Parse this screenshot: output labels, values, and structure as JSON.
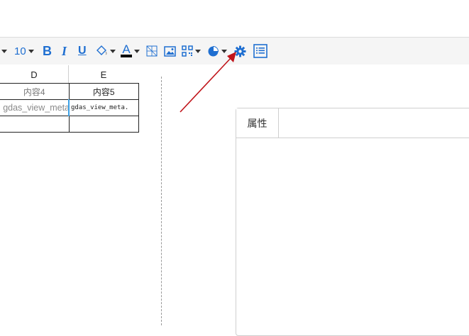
{
  "toolbar": {
    "font_size": "10",
    "bold": "B",
    "italic": "I",
    "underline": "U",
    "font_color_letter": "A",
    "accent_color": "#1f6fd1"
  },
  "columns": [
    "D",
    "E"
  ],
  "rows": [
    [
      "内容4",
      "内容5"
    ],
    [
      "gdas_view_meta",
      "gdas_view_meta."
    ],
    [
      "",
      ""
    ]
  ],
  "panel": {
    "tab_label": "属性"
  },
  "annotation": {
    "arrow_color": "#c0141a"
  }
}
